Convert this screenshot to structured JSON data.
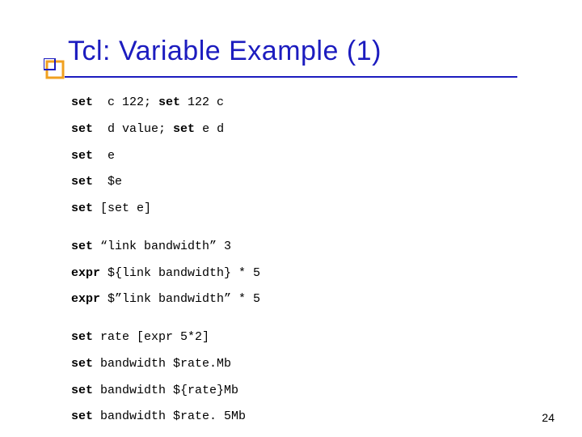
{
  "title": "Tcl: Variable Example (1)",
  "page_number": "24",
  "lines": {
    "l01a": "set",
    "l01b": "  c 122; ",
    "l01c": "set",
    "l01d": " 122 c",
    "l02a": "set",
    "l02b": "  d value; ",
    "l02c": "set",
    "l02d": " e d",
    "l03a": "set",
    "l03b": "  e",
    "l04a": "set",
    "l04b": "  $e",
    "l05a": "set",
    "l05b": " [set e]",
    "l06a": "set",
    "l06b": " “link bandwidth” 3",
    "l07a": "expr",
    "l07b": " ${link bandwidth} * 5",
    "l08a": "expr",
    "l08b": " $”link bandwidth” * 5",
    "l09a": "set",
    "l09b": " rate [expr 5*2]",
    "l10a": "set",
    "l10b": " bandwidth $rate.Mb",
    "l11a": "set",
    "l11b": " bandwidth ${rate}Mb",
    "l12a": "set",
    "l12b": " bandwidth $rate. 5Mb"
  }
}
